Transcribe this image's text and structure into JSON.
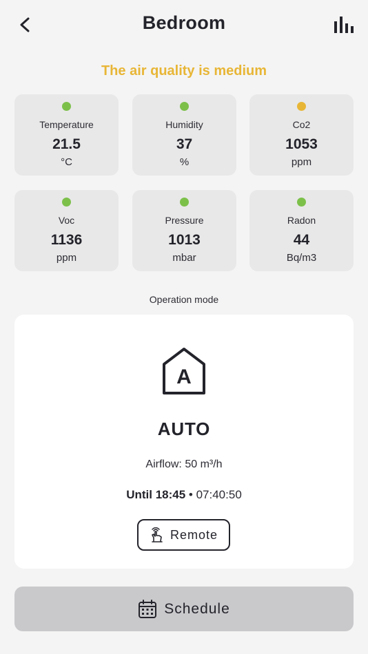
{
  "header": {
    "title": "Bedroom",
    "back_icon": "chevron-left-icon",
    "stats_icon": "bar-chart-icon"
  },
  "status": {
    "text": "The air quality is medium",
    "color": "#e8b636"
  },
  "colors": {
    "good": "#7cc04a",
    "medium": "#e8b636"
  },
  "sensors": [
    {
      "name": "Temperature",
      "value": "21.5",
      "unit": "°C",
      "status": "good"
    },
    {
      "name": "Humidity",
      "value": "37",
      "unit": "%",
      "status": "good"
    },
    {
      "name": "Co2",
      "value": "1053",
      "unit": "ppm",
      "status": "medium"
    },
    {
      "name": "Voc",
      "value": "1136",
      "unit": "ppm",
      "status": "good"
    },
    {
      "name": "Pressure",
      "value": "1013",
      "unit": "mbar",
      "status": "good"
    },
    {
      "name": "Radon",
      "value": "44",
      "unit": "Bq/m3",
      "status": "good"
    }
  ],
  "operation": {
    "label": "Operation mode",
    "mode_icon": "auto-mode-house-icon",
    "mode_letter": "A",
    "mode": "AUTO",
    "airflow": "Airflow: 50 m³/h",
    "until_time": "Until 18:45",
    "separator": " • ",
    "countdown": "07:40:50",
    "remote_label": "Remote",
    "remote_icon": "remote-hand-icon"
  },
  "schedule": {
    "label": "Schedule",
    "icon": "calendar-icon"
  }
}
